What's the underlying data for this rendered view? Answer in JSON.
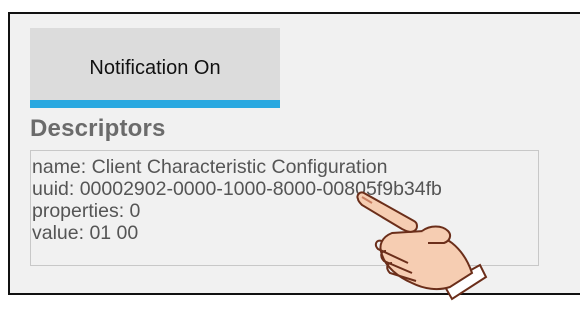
{
  "tab": {
    "label": "Notification On",
    "indicator_color": "#29a8e0"
  },
  "descriptors": {
    "title": "Descriptors",
    "lines": [
      "name: Client Characteristic Configuration",
      "uuid: 00002902-0000-1000-8000-00805f9b34fb",
      "properties: 0",
      "value: 01 00"
    ]
  },
  "overlay": {
    "icon": "pointing-hand-icon"
  }
}
